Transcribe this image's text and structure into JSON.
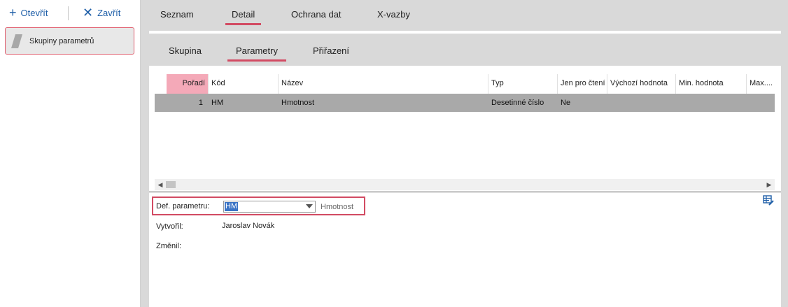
{
  "toolbar": {
    "open_label": "Otevřít",
    "close_label": "Zavřít"
  },
  "left_panel": {
    "item_label": "Skupiny parametrů"
  },
  "tabs": [
    {
      "label": "Seznam"
    },
    {
      "label": "Detail",
      "active": true
    },
    {
      "label": "Ochrana dat"
    },
    {
      "label": "X-vazby"
    }
  ],
  "subtabs": [
    {
      "label": "Skupina"
    },
    {
      "label": "Parametry",
      "active": true
    },
    {
      "label": "Přiřazení"
    }
  ],
  "grid": {
    "columns": [
      "Pořadí",
      "Kód",
      "Název",
      "Typ",
      "Jen pro čtení",
      "Výchozí hodnota",
      "Min. hodnota",
      "Max...."
    ],
    "rows": [
      [
        "1",
        "HM",
        "Hmotnost",
        "Desetinné číslo",
        "Ne",
        "",
        "",
        ""
      ]
    ]
  },
  "form": {
    "def_label": "Def. parametru:",
    "def_value": "HM",
    "def_desc": "Hmotnost",
    "created_label": "Vytvořil:",
    "created_value": "Jaroslav Novák",
    "changed_label": "Změnil:"
  },
  "colors": {
    "accent": "#d24b63",
    "link": "#1f5fa8",
    "sorted_header": "#f4a9b8",
    "selected_row": "#a9a9a9",
    "selection": "#3a73c5"
  }
}
